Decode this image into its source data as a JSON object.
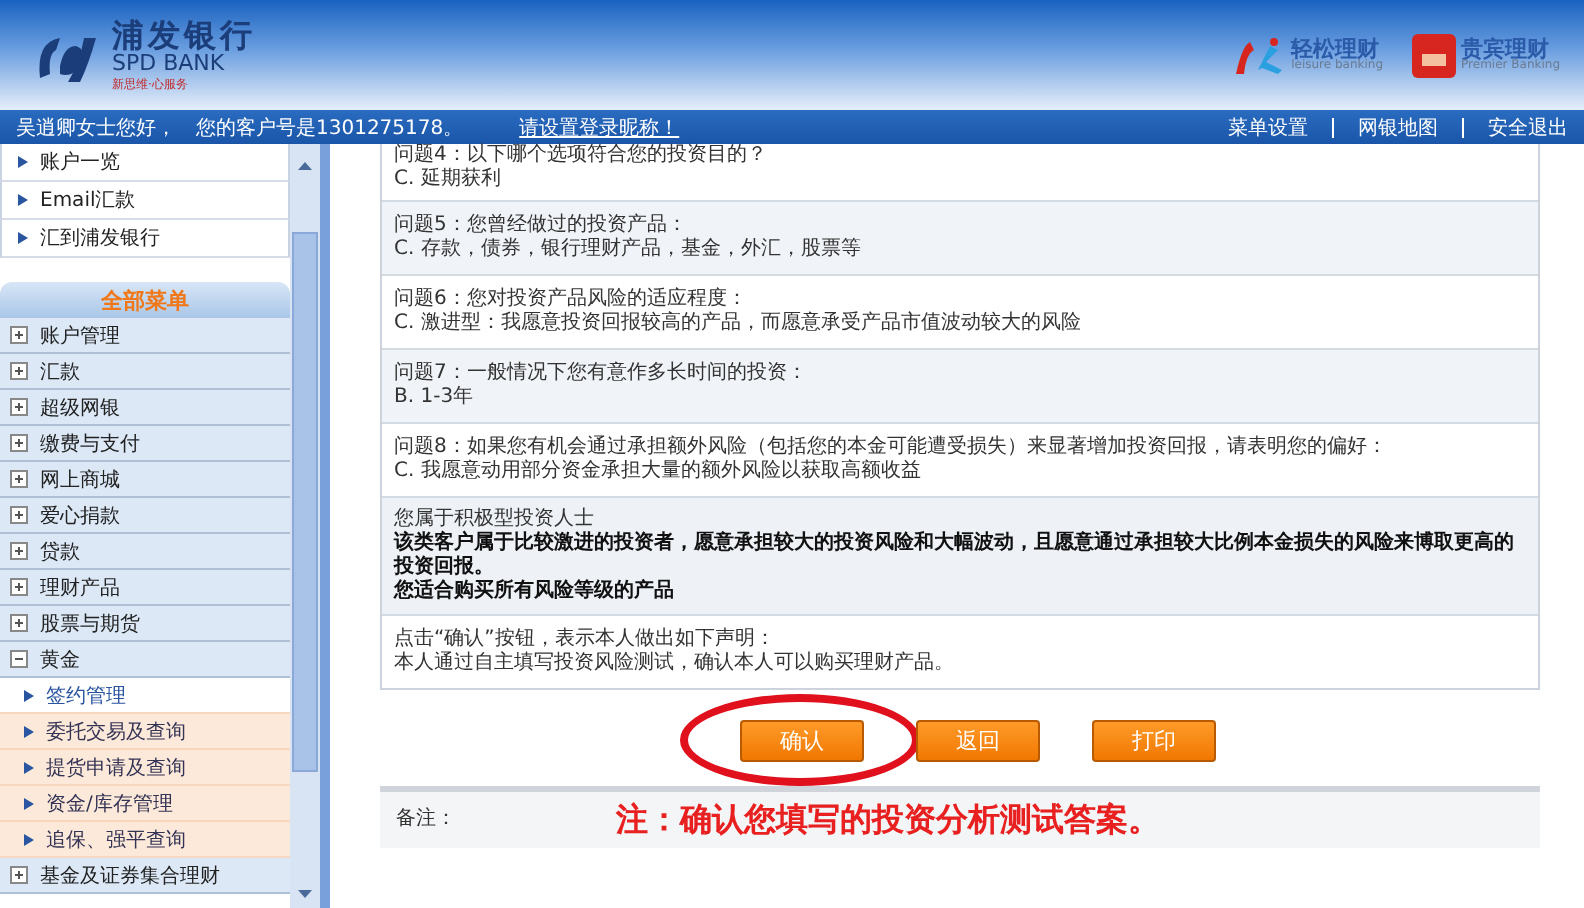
{
  "header": {
    "bank_name": "浦发银行",
    "bank_name_en": "SPD BANK",
    "slogan": "新思维·心服务",
    "brands": [
      {
        "kind": "leisure",
        "name": "轻松理财",
        "subtitle": "leisure banking"
      },
      {
        "kind": "premier",
        "name": "贵宾理财",
        "subtitle": "Premier Banking"
      }
    ]
  },
  "user_bar": {
    "greeting": "吴逍卿女士您好，",
    "customer_no": "您的客户号是1301275178。",
    "login_link": "请设置登录昵称！",
    "links": [
      "菜单设置",
      "网银地图",
      "安全退出"
    ]
  },
  "sidebar": {
    "quick_links": [
      "账户一览",
      "Email汇款",
      "汇到浦发银行"
    ],
    "menu_title": "全部菜单",
    "items": [
      {
        "label": "账户管理",
        "expanded": false
      },
      {
        "label": "汇款",
        "expanded": false
      },
      {
        "label": "超级网银",
        "expanded": false
      },
      {
        "label": "缴费与支付",
        "expanded": false
      },
      {
        "label": "网上商城",
        "expanded": false
      },
      {
        "label": "爱心捐款",
        "expanded": false
      },
      {
        "label": "贷款",
        "expanded": false
      },
      {
        "label": "理财产品",
        "expanded": false
      },
      {
        "label": "股票与期货",
        "expanded": false
      },
      {
        "label": "黄金",
        "expanded": true,
        "children": [
          {
            "label": "签约管理",
            "selected": true
          },
          {
            "label": "委托交易及查询",
            "selected": false
          },
          {
            "label": "提货申请及查询",
            "selected": false
          },
          {
            "label": "资金/库存管理",
            "selected": false
          },
          {
            "label": "追保、强平查询",
            "selected": false
          }
        ]
      },
      {
        "label": "基金及证券集合理财",
        "expanded": false
      }
    ]
  },
  "questions": [
    {
      "question": "问题4：以下哪个选项符合您的投资目的？",
      "answer": "C. 延期获利"
    },
    {
      "question": "问题5：您曾经做过的投资产品：",
      "answer": "C. 存款，债券，银行理财产品，基金，外汇，股票等"
    },
    {
      "question": "问题6：您对投资产品风险的适应程度：",
      "answer": "C. 激进型：我愿意投资回报较高的产品，而愿意承受产品市值波动较大的风险"
    },
    {
      "question": "问题7：一般情况下您有意作多长时间的投资：",
      "answer": "B. 1-3年"
    },
    {
      "question": "问题8：如果您有机会通过承担额外风险（包括您的本金可能遭受损失）来显著增加投资回报，请表明您的偏好：",
      "answer": "C. 我愿意动用部分资金承担大量的额外风险以获取高额收益"
    }
  ],
  "result": {
    "title": "您属于积极型投资人士",
    "lines": [
      "该类客户属于比较激进的投资者，愿意承担较大的投资风险和大幅波动，且愿意通过承担较大比例本金损失的风险来博取更高的投资回报。",
      "您适合购买所有风险等级的产品"
    ]
  },
  "statement": [
    "点击“确认”按钮，表示本人做出如下声明：",
    "本人通过自主填写投资风险测试，确认本人可以购买理财产品。"
  ],
  "buttons": [
    {
      "label": "确认",
      "circled": true
    },
    {
      "label": "返回",
      "circled": false
    },
    {
      "label": "打印",
      "circled": false
    }
  ],
  "note": {
    "label": "备注：",
    "annotation": "注：确认您填写的投资分析测试答案。"
  }
}
